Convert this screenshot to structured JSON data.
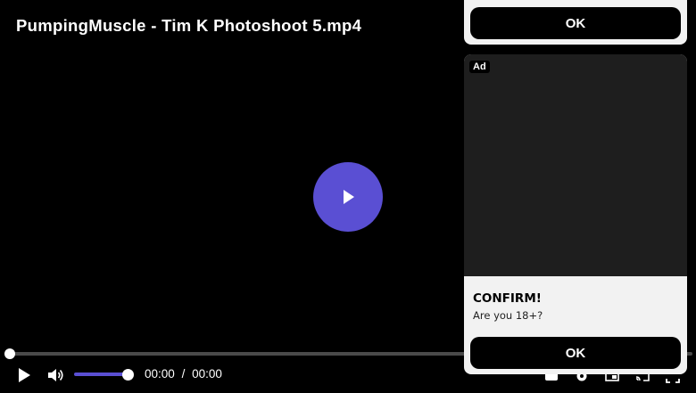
{
  "video": {
    "title": "PumpingMuscle - Tim K Photoshoot 5.mp4",
    "progress_fraction": 0,
    "volume_fraction": 1,
    "current_time": "00:00",
    "time_separator": "/",
    "duration": "00:00",
    "accent_color": "#5a4fd3",
    "icons": [
      "play-icon",
      "volume-icon",
      "captions-icon",
      "settings-icon",
      "pip-icon",
      "cast-icon",
      "fullscreen-icon"
    ]
  },
  "ad": {
    "top_ok_label": "OK",
    "badge": "Ad",
    "heading": "CONFIRM!",
    "subtext": "Are you 18+?",
    "ok_label": "OK"
  }
}
